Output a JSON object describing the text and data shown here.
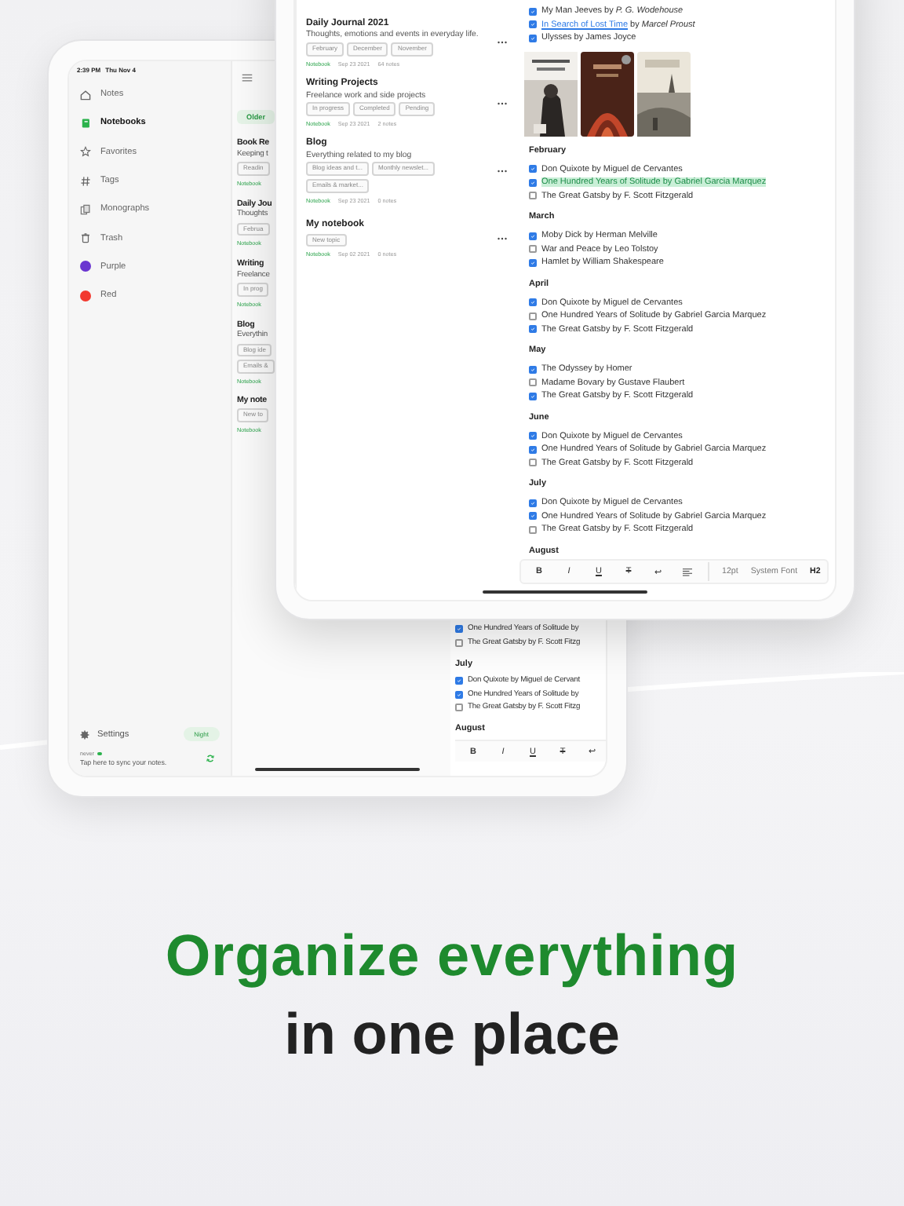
{
  "back_tablet": {
    "status_bar": {
      "time": "2:39 PM",
      "date": "Thu Nov 4"
    },
    "sidebar": {
      "items": [
        {
          "label": "Notes",
          "kind": "nav",
          "selected": false
        },
        {
          "label": "Notebooks",
          "kind": "nav",
          "selected": true
        },
        {
          "label": "Favorites",
          "kind": "nav",
          "selected": false
        },
        {
          "label": "Tags",
          "kind": "nav",
          "selected": false
        },
        {
          "label": "Monographs",
          "kind": "nav",
          "selected": false
        },
        {
          "label": "Trash",
          "kind": "nav",
          "selected": false
        },
        {
          "label": "Purple",
          "kind": "color",
          "color": "#6a35d0",
          "selected": false
        },
        {
          "label": "Red",
          "kind": "color",
          "color": "#f2392f",
          "selected": false
        }
      ],
      "settings_label": "Settings",
      "night_button": "Night",
      "sync_status": "never",
      "sync_hint": "Tap here to sync your notes."
    },
    "list": {
      "filter": "Older",
      "notebooks": [
        {
          "title": "Book Re",
          "description": "Keeping t",
          "tags": [
            "Readin"
          ],
          "category": "Notebook"
        },
        {
          "title": "Daily Jou",
          "description": "Thoughts",
          "tags": [
            "Februa"
          ],
          "category": "Notebook"
        },
        {
          "title": "Writing",
          "description": "Freelance",
          "tags": [
            "In prog"
          ],
          "category": "Notebook"
        },
        {
          "title": "Blog",
          "description": "Everythin",
          "tags": [
            "Blog ide",
            "Emails &"
          ],
          "category": "Notebook"
        },
        {
          "title": "My note",
          "tags": [
            "New to"
          ],
          "category": "Notebook"
        }
      ]
    },
    "editor": {
      "sections": [
        {
          "items": [
            {
              "text": "One Hundred Years of Solitude by",
              "checked": true
            },
            {
              "text": "The Great Gatsby by F. Scott Fitzg",
              "checked": false
            }
          ]
        },
        {
          "heading": "July",
          "items": [
            {
              "text": "Don Quixote by Miguel de Cervant",
              "checked": true
            },
            {
              "text": "One Hundred Years of Solitude by",
              "checked": true
            },
            {
              "text": "The Great Gatsby by F. Scott Fitzg",
              "checked": false
            }
          ]
        },
        {
          "heading": "August"
        }
      ],
      "toolbar": [
        {
          "label": "B",
          "kind": "bold"
        },
        {
          "label": "I",
          "kind": "italic"
        },
        {
          "label": "U",
          "kind": "underline"
        },
        {
          "label": "T",
          "kind": "strike"
        },
        {
          "label": "↩",
          "kind": "plain"
        }
      ]
    }
  },
  "front_tablet": {
    "list": {
      "notebooks": [
        {
          "title": "Daily Journal 2021",
          "description": "Thoughts, emotions and events in everyday life.",
          "tags": [
            "February",
            "December",
            "November"
          ],
          "category": "Notebook",
          "date": "Sep 23 2021",
          "count": "64 notes"
        },
        {
          "title": "Writing Projects",
          "description": "Freelance work and side projects",
          "tags": [
            "In progress",
            "Completed",
            "Pending"
          ],
          "category": "Notebook",
          "date": "Sep 23 2021",
          "count": "2 notes"
        },
        {
          "title": "Blog",
          "description": "Everything related to my blog",
          "tags": [
            "Blog ideas and t...",
            "Monthly newslet...",
            "Emails & market..."
          ],
          "category": "Notebook",
          "date": "Sep 23 2021",
          "count": "0 notes"
        },
        {
          "title": "My notebook",
          "tags": [
            "New topic"
          ],
          "category": "Notebook",
          "date": "Sep 02 2021",
          "count": "0 notes"
        }
      ]
    },
    "editor": {
      "top_items": [
        {
          "text": "My Man Jeeves by *P. G. Wodehouse*",
          "checked": true,
          "highlighted": false
        },
        {
          "link": "In Search of Lost Time",
          "text": " by *Marcel Proust*",
          "checked": true,
          "highlighted": false
        },
        {
          "text": "Ulysses by James Joyce",
          "checked": true,
          "highlighted": false
        }
      ],
      "sections": [
        {
          "heading": "February",
          "items": [
            {
              "text": "Don Quixote by Miguel de Cervantes",
              "checked": true,
              "highlighted": false
            },
            {
              "text": "One Hundred Years of Solitude by Gabriel Garcia Marquez",
              "checked": true,
              "highlighted": true
            },
            {
              "text": "The Great Gatsby by F. Scott Fitzgerald",
              "checked": false,
              "highlighted": false
            }
          ]
        },
        {
          "heading": "March",
          "items": [
            {
              "text": "Moby Dick by Herman Melville",
              "checked": true,
              "highlighted": false
            },
            {
              "text": "War and Peace by Leo Tolstoy",
              "checked": false,
              "highlighted": false
            },
            {
              "text": "Hamlet by William Shakespeare",
              "checked": true,
              "highlighted": false
            }
          ]
        },
        {
          "heading": "April",
          "items": [
            {
              "text": "Don Quixote by Miguel de Cervantes",
              "checked": true,
              "highlighted": false
            },
            {
              "text": "One Hundred Years of Solitude by Gabriel Garcia Marquez",
              "checked": false,
              "highlighted": false
            },
            {
              "text": "The Great Gatsby by F. Scott Fitzgerald",
              "checked": true,
              "highlighted": false
            }
          ]
        },
        {
          "heading": "May",
          "items": [
            {
              "text": "The Odyssey by Homer",
              "checked": true,
              "highlighted": false
            },
            {
              "text": "Madame Bovary by Gustave Flaubert",
              "checked": false,
              "highlighted": false
            },
            {
              "text": "The Great Gatsby by F. Scott Fitzgerald",
              "checked": true,
              "highlighted": false
            }
          ]
        },
        {
          "heading": "June",
          "items": [
            {
              "text": "Don Quixote by Miguel de Cervantes",
              "checked": true,
              "highlighted": false
            },
            {
              "text": "One Hundred Years of Solitude by Gabriel Garcia Marquez",
              "checked": true,
              "highlighted": false
            },
            {
              "text": "The Great Gatsby by F. Scott Fitzgerald",
              "checked": false,
              "highlighted": false
            }
          ]
        },
        {
          "heading": "July",
          "items": [
            {
              "text": "Don Quixote by Miguel de Cervantes",
              "checked": true,
              "highlighted": false
            },
            {
              "text": "One Hundred Years of Solitude by Gabriel Garcia Marquez",
              "checked": true,
              "highlighted": false
            },
            {
              "text": "The Great Gatsby by F. Scott Fitzgerald",
              "checked": false,
              "highlighted": false
            }
          ]
        },
        {
          "heading": "August"
        }
      ],
      "toolbar": [
        {
          "label": "B",
          "kind": "bold"
        },
        {
          "label": "I",
          "kind": "italic"
        },
        {
          "label": "U",
          "kind": "underline"
        },
        {
          "label": "T",
          "kind": "strike"
        },
        {
          "label": "↩",
          "kind": "plain"
        },
        {
          "kind": "align"
        }
      ],
      "font_size": "12pt",
      "font": "System Font",
      "heading_style": "H2"
    }
  },
  "headline": {
    "line_1": "Organize everything",
    "line_2": "in one place"
  }
}
